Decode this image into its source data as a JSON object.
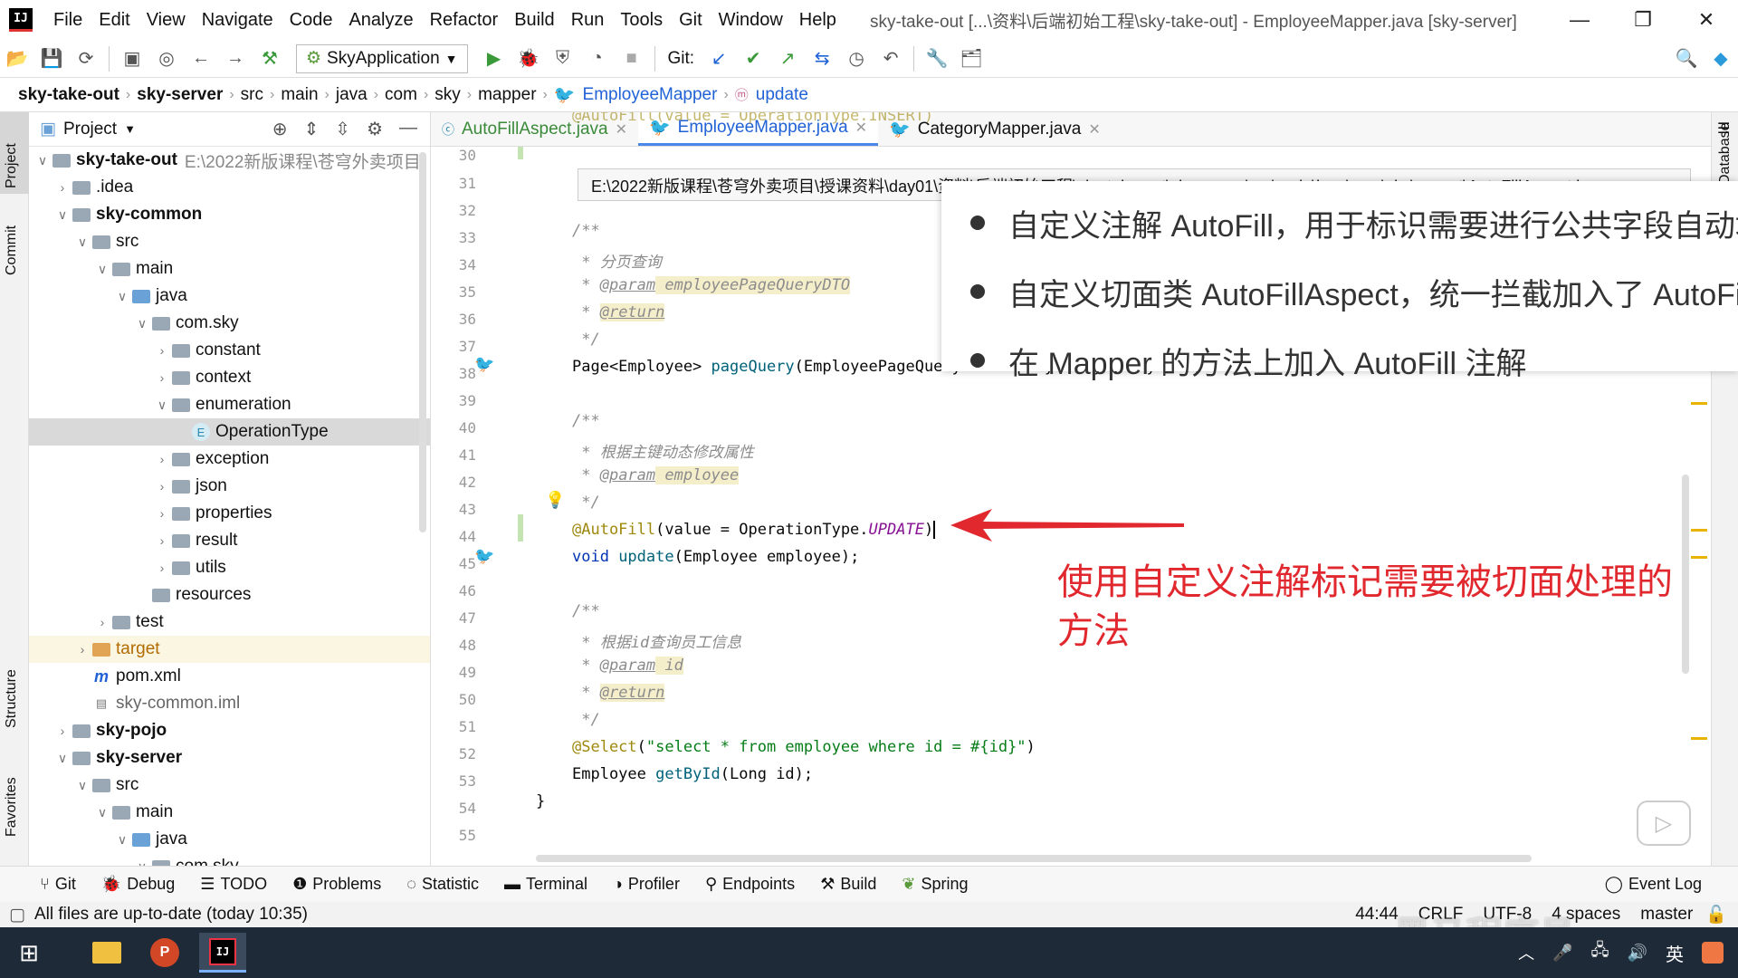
{
  "app": {
    "logo": "IJ",
    "menu": [
      "File",
      "Edit",
      "View",
      "Navigate",
      "Code",
      "Analyze",
      "Refactor",
      "Build",
      "Run",
      "Tools",
      "Git",
      "Window",
      "Help"
    ],
    "title": "sky-take-out [...\\资料\\后端初始工程\\sky-take-out] - EmployeeMapper.java [sky-server]"
  },
  "toolbar": {
    "run_config": "SkyApplication",
    "git_label": "Git:"
  },
  "breadcrumb": [
    "sky-take-out",
    "sky-server",
    "src",
    "main",
    "java",
    "com",
    "sky",
    "mapper",
    "EmployeeMapper",
    "update"
  ],
  "side_left": {
    "project": "Project",
    "commit": "Commit",
    "structure": "Structure",
    "favorites": "Favorites"
  },
  "side_right": {
    "database": "Database"
  },
  "project_panel": {
    "title": "Project",
    "tree": [
      {
        "label": "sky-take-out",
        "extra": "E:\\2022新版课程\\苍穹外卖项目",
        "indent": 0
      },
      {
        "label": ".idea",
        "indent": 1
      },
      {
        "label": "sky-common",
        "indent": 1
      },
      {
        "label": "src",
        "indent": 2
      },
      {
        "label": "main",
        "indent": 3
      },
      {
        "label": "java",
        "indent": 4
      },
      {
        "label": "com.sky",
        "indent": 5
      },
      {
        "label": "constant",
        "indent": 6
      },
      {
        "label": "context",
        "indent": 6
      },
      {
        "label": "enumeration",
        "indent": 6
      },
      {
        "label": "OperationType",
        "indent": 7
      },
      {
        "label": "exception",
        "indent": 6
      },
      {
        "label": "json",
        "indent": 6
      },
      {
        "label": "properties",
        "indent": 6
      },
      {
        "label": "result",
        "indent": 6
      },
      {
        "label": "utils",
        "indent": 6
      },
      {
        "label": "resources",
        "indent": 4
      },
      {
        "label": "test",
        "indent": 3
      },
      {
        "label": "target",
        "indent": 2
      },
      {
        "label": "pom.xml",
        "indent": 2
      },
      {
        "label": "sky-common.iml",
        "indent": 2
      },
      {
        "label": "sky-pojo",
        "indent": 1
      },
      {
        "label": "sky-server",
        "indent": 1
      },
      {
        "label": "src",
        "indent": 2
      },
      {
        "label": "main",
        "indent": 3
      },
      {
        "label": "java",
        "indent": 4
      },
      {
        "label": "com.sky",
        "indent": 5
      }
    ]
  },
  "tabs": [
    "AutoFillAspect.java",
    "EmployeeMapper.java",
    "CategoryMapper.java"
  ],
  "tooltip": "E:\\2022新版课程\\苍穹外卖项目\\授课资料\\day01\\资料\\后端初始工程\\sky-take-out\\sky-server\\src\\main\\java\\com\\sky\\aspect\\AutoFillAspect.java",
  "line_numbers": [
    "30",
    "31",
    "32",
    "33",
    "34",
    "35",
    "36",
    "37",
    "38",
    "39",
    "40",
    "41",
    "42",
    "43",
    "44",
    "45",
    "46",
    "47",
    "48",
    "49",
    "50",
    "51",
    "52",
    "53",
    "54",
    "55"
  ],
  "code": {
    "l30": "@AutoFill(value = OperationType.INSERT)",
    "l33": "/**",
    "l34_a": " * ",
    "l34_b": "分页查询",
    "l35_a": " * ",
    "l35_tag": "@param",
    "l35_b": " employeePageQueryDTO",
    "l36_a": " * ",
    "l36_tag": "@return",
    "l37": " */",
    "l38_a": "Page<Employee> ",
    "l38_fn": "pageQuery",
    "l38_b": "(EmployeePageQueryDTO employeePageQueryDTO);",
    "l40": "/**",
    "l41_a": " * ",
    "l41_b": "根据主键动态修改属性",
    "l42_a": " * ",
    "l42_tag": "@param",
    "l42_b": " employee",
    "l43": " */",
    "l44_ann": "@AutoFill",
    "l44_a": "(value = OperationType.",
    "l44_const": "UPDATE",
    "l44_b": ")",
    "l45_kw": "void ",
    "l45_fn": "update",
    "l45_b": "(Employee employee);",
    "l47": "/**",
    "l48_a": " * ",
    "l48_b": "根据id查询员工信息",
    "l49_a": " * ",
    "l49_tag": "@param",
    "l49_b": " id",
    "l50_a": " * ",
    "l50_tag": "@return",
    "l51": " */",
    "l52_ann": "@Select",
    "l52_a": "(",
    "l52_str": "\"select * from employee where id = #{id}\"",
    "l52_b": ")",
    "l53_a": "Employee ",
    "l53_fn": "getById",
    "l53_b": "(Long id);",
    "l54": "}"
  },
  "overlay": {
    "bullets": [
      "自定义注解 AutoFill，用于标识需要进行公共字段自动填充",
      "自定义切面类 AutoFillAspect，统一拦截加入了 AutoFill 注解的方法",
      "在 Mapper 的方法上加入 AutoFill 注解"
    ],
    "red_note": "使用自定义注解标记需要被切面处理的方法",
    "red_color": "#e0282e"
  },
  "tool_windows": [
    "Git",
    "Debug",
    "TODO",
    "Problems",
    "Statistic",
    "Terminal",
    "Profiler",
    "Endpoints",
    "Build",
    "Spring",
    "Event Log"
  ],
  "status": {
    "message": "All files are up-to-date (today 10:35)",
    "position": "44:44",
    "line_sep": "CRLF",
    "encoding": "UTF-8",
    "indent": "4 spaces",
    "branch": "master"
  },
  "taskbar": {
    "ime": "英"
  },
  "watermark": "黑马程序员"
}
